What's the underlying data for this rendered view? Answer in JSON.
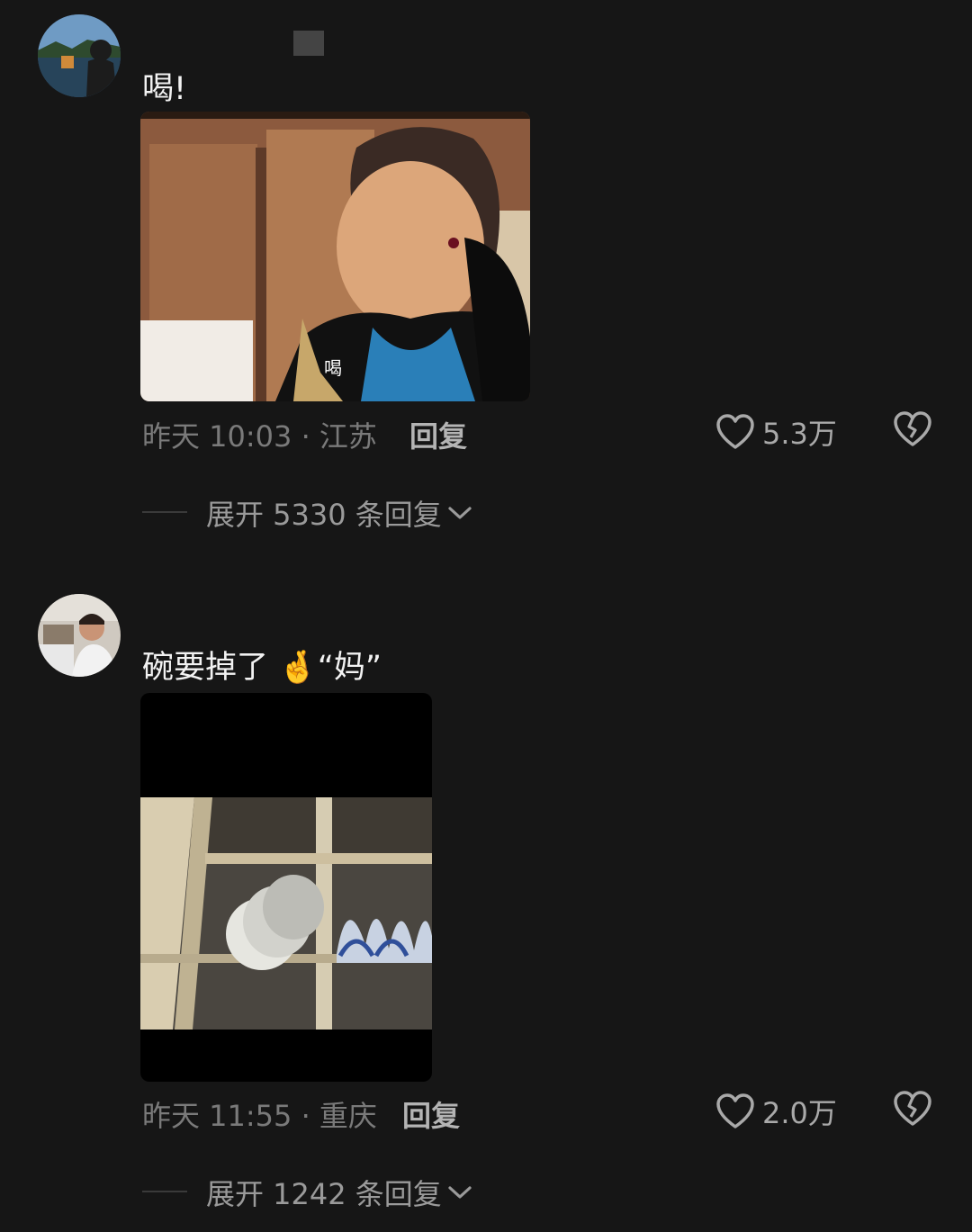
{
  "comments": [
    {
      "username": "",
      "text": "喝!",
      "media_caption": "喝",
      "time_location": "昨天 10:03 · 江苏",
      "reply_label": "回复",
      "like_count": "5.3万",
      "expand_label": "展开 5330 条回复"
    },
    {
      "username": "",
      "text": "碗要掉了 🤞“妈”",
      "time_location": "昨天 11:55 · 重庆",
      "reply_label": "回复",
      "like_count": "2.0万",
      "expand_label": "展开 1242 条回复"
    }
  ],
  "icons": {
    "like": "heart-outline-icon",
    "dislike": "broken-heart-icon",
    "expand": "chevron-down-icon"
  },
  "colors": {
    "background": "#161616",
    "text_primary": "#f2f2f2",
    "text_secondary": "#7a7a7a",
    "reply": "#b4b4b4"
  }
}
